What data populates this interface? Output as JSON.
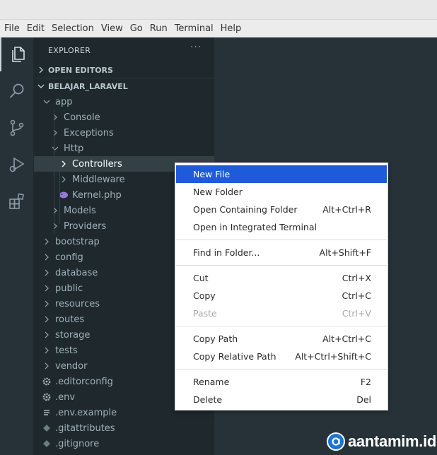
{
  "menubar": {
    "items": [
      "File",
      "Edit",
      "Selection",
      "View",
      "Go",
      "Run",
      "Terminal",
      "Help"
    ]
  },
  "activity_bar": {
    "icons": [
      "explorer-icon",
      "search-icon",
      "source-control-icon",
      "run-debug-icon",
      "extensions-icon"
    ]
  },
  "sidebar": {
    "title": "EXPLORER",
    "more_actions": "···",
    "open_editors_label": "OPEN EDITORS",
    "project_label": "BELAJAR_LARAVEL",
    "tree": [
      {
        "label": "app",
        "type": "folder",
        "expanded": true,
        "depth": 1
      },
      {
        "label": "Console",
        "type": "folder",
        "expanded": false,
        "depth": 2
      },
      {
        "label": "Exceptions",
        "type": "folder",
        "expanded": false,
        "depth": 2
      },
      {
        "label": "Http",
        "type": "folder",
        "expanded": true,
        "depth": 2
      },
      {
        "label": "Controllers",
        "type": "folder",
        "expanded": false,
        "depth": 3,
        "selected": true
      },
      {
        "label": "Middleware",
        "type": "folder",
        "expanded": false,
        "depth": 3
      },
      {
        "label": "Kernel.php",
        "type": "php-file",
        "depth": 3
      },
      {
        "label": "Models",
        "type": "folder",
        "expanded": false,
        "depth": 2
      },
      {
        "label": "Providers",
        "type": "folder",
        "expanded": false,
        "depth": 2
      },
      {
        "label": "bootstrap",
        "type": "folder",
        "expanded": false,
        "depth": 1
      },
      {
        "label": "config",
        "type": "folder",
        "expanded": false,
        "depth": 1
      },
      {
        "label": "database",
        "type": "folder",
        "expanded": false,
        "depth": 1
      },
      {
        "label": "public",
        "type": "folder",
        "expanded": false,
        "depth": 1
      },
      {
        "label": "resources",
        "type": "folder",
        "expanded": false,
        "depth": 1
      },
      {
        "label": "routes",
        "type": "folder",
        "expanded": false,
        "depth": 1
      },
      {
        "label": "storage",
        "type": "folder",
        "expanded": false,
        "depth": 1
      },
      {
        "label": "tests",
        "type": "folder",
        "expanded": false,
        "depth": 1
      },
      {
        "label": "vendor",
        "type": "folder",
        "expanded": false,
        "depth": 1
      },
      {
        "label": ".editorconfig",
        "type": "gear-file",
        "depth": 1
      },
      {
        "label": ".env",
        "type": "gear-file",
        "depth": 1
      },
      {
        "label": ".env.example",
        "type": "lines-file",
        "depth": 1
      },
      {
        "label": ".gitattributes",
        "type": "git-file",
        "depth": 1
      },
      {
        "label": ".gitignore",
        "type": "git-file",
        "depth": 1
      }
    ]
  },
  "context_menu": {
    "groups": [
      [
        {
          "label": "New File",
          "shortcut": "",
          "highlighted": true
        },
        {
          "label": "New Folder",
          "shortcut": ""
        },
        {
          "label": "Open Containing Folder",
          "shortcut": "Alt+Ctrl+R"
        },
        {
          "label": "Open in Integrated Terminal",
          "shortcut": ""
        }
      ],
      [
        {
          "label": "Find in Folder...",
          "shortcut": "Alt+Shift+F"
        }
      ],
      [
        {
          "label": "Cut",
          "shortcut": "Ctrl+X"
        },
        {
          "label": "Copy",
          "shortcut": "Ctrl+C"
        },
        {
          "label": "Paste",
          "shortcut": "Ctrl+V",
          "disabled": true
        }
      ],
      [
        {
          "label": "Copy Path",
          "shortcut": "Alt+Ctrl+C"
        },
        {
          "label": "Copy Relative Path",
          "shortcut": "Alt+Ctrl+Shift+C"
        }
      ],
      [
        {
          "label": "Rename",
          "shortcut": "F2"
        },
        {
          "label": "Delete",
          "shortcut": "Del"
        }
      ]
    ]
  },
  "watermark": {
    "text": "aantamim.id"
  },
  "colors": {
    "sidebar_bg": "#1e282d",
    "editor_bg": "#263238",
    "menu_highlight": "#1e5bd8",
    "selected_row": "#334046"
  }
}
